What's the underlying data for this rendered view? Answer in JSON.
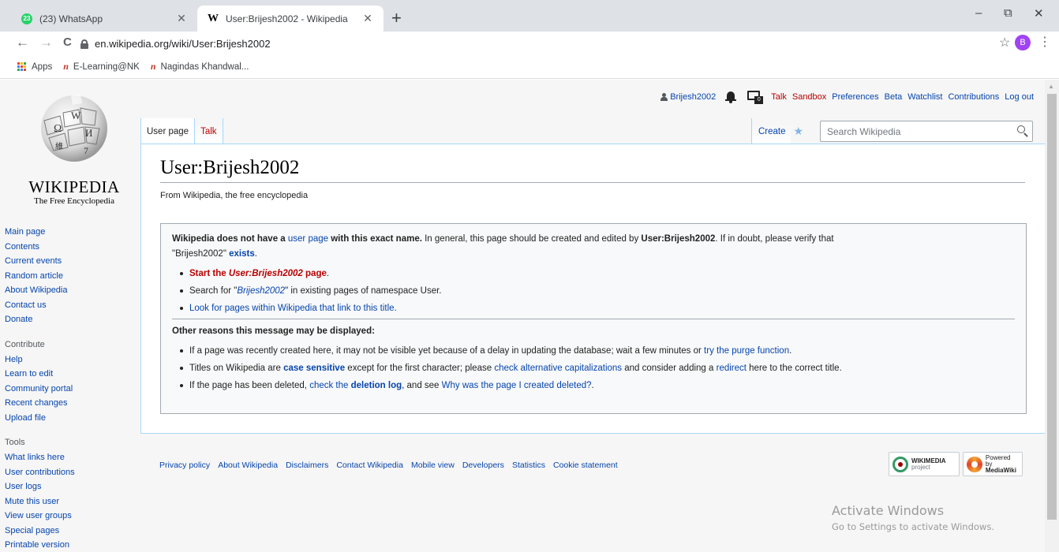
{
  "browser": {
    "tabs": [
      {
        "title": "(23) WhatsApp",
        "badge": "23"
      },
      {
        "title": "User:Brijesh2002 - Wikipedia",
        "favicon": "W"
      }
    ],
    "new_tab": "+",
    "window_controls": {
      "minimize": "–",
      "restore": "⧉",
      "close": "✕"
    },
    "nav": {
      "back": "←",
      "forward": "→",
      "reload": "C"
    },
    "url": "en.wikipedia.org/wiki/User:Brijesh2002",
    "profile_initial": "B",
    "bookmarks": [
      "Apps",
      "E-Learning@NK",
      "Nagindas Khandwal..."
    ]
  },
  "wiki": {
    "logo": {
      "wordmark": "WIKIPEDIA",
      "tagline": "The Free Encyclopedia"
    },
    "personal": {
      "username": "Brijesh2002",
      "notice_count": "0",
      "links": [
        "Talk",
        "Sandbox",
        "Preferences",
        "Beta",
        "Watchlist",
        "Contributions",
        "Log out"
      ]
    },
    "tabs": {
      "user_page": "User page",
      "talk": "Talk",
      "create": "Create"
    },
    "search": {
      "placeholder": "Search Wikipedia"
    },
    "sidebar": {
      "nav": [
        "Main page",
        "Contents",
        "Current events",
        "Random article",
        "About Wikipedia",
        "Contact us",
        "Donate"
      ],
      "contribute_heading": "Contribute",
      "contribute": [
        "Help",
        "Learn to edit",
        "Community portal",
        "Recent changes",
        "Upload file"
      ],
      "tools_heading": "Tools",
      "tools": [
        "What links here",
        "User contributions",
        "User logs",
        "Mute this user",
        "View user groups",
        "Special pages",
        "Printable version"
      ]
    },
    "heading": "User:Brijesh2002",
    "tagline": "From Wikipedia, the free encyclopedia",
    "notice": {
      "p1_bold_a": "Wikipedia does not have a ",
      "p1_link": "user page",
      "p1_bold_b": " with this exact name.",
      "p1_text": " In general, this page should be created and edited by ",
      "p1_user": "User:Brijesh2002",
      "p1_text2": ". If in doubt, please verify that",
      "p1_quote": "\"Brijesh2002\" ",
      "p1_exists": "exists",
      "p1_end": ".",
      "b1_a": "Start the ",
      "b1_italic": "User:Brijesh2002",
      "b1_b": " page",
      "b1_end": ".",
      "b2_a": "Search for \"",
      "b2_italic": "Brijesh2002",
      "b2_b": "\" in existing pages of namespace User.",
      "b3": "Look for pages within Wikipedia that link to this title.",
      "reasons_heading": "Other reasons this message may be displayed:",
      "r1_a": "If a page was recently created here, it may not be visible yet because of a delay in updating the database; wait a few minutes or ",
      "r1_link": "try the purge function",
      "r1_end": ".",
      "r2_a": "Titles on Wikipedia are ",
      "r2_link1": "case sensitive",
      "r2_b": " except for the first character; please ",
      "r2_link2": "check alternative capitalizations",
      "r2_c": " and consider adding a ",
      "r2_link3": "redirect",
      "r2_d": " here to the correct title.",
      "r3_a": "If the page has been deleted, ",
      "r3_link1a": "check the ",
      "r3_link1b": "deletion log",
      "r3_b": ", and see ",
      "r3_link2": "Why was the page I created deleted?",
      "r3_end": "."
    },
    "footer": [
      "Privacy policy",
      "About Wikipedia",
      "Disclaimers",
      "Contact Wikipedia",
      "Mobile view",
      "Developers",
      "Statistics",
      "Cookie statement"
    ],
    "badges": {
      "wikimedia": {
        "line1": "WIKIMEDIA",
        "line2": "project"
      },
      "mediawiki": {
        "line1": "Powered by",
        "line2": "MediaWiki"
      }
    }
  },
  "os_overlay": {
    "line1": "Activate Windows",
    "line2": "Go to Settings to activate Windows."
  },
  "colors": {
    "link": "#0645ad",
    "redlink": "#ba0000",
    "tab_border": "#a7d7f9"
  }
}
